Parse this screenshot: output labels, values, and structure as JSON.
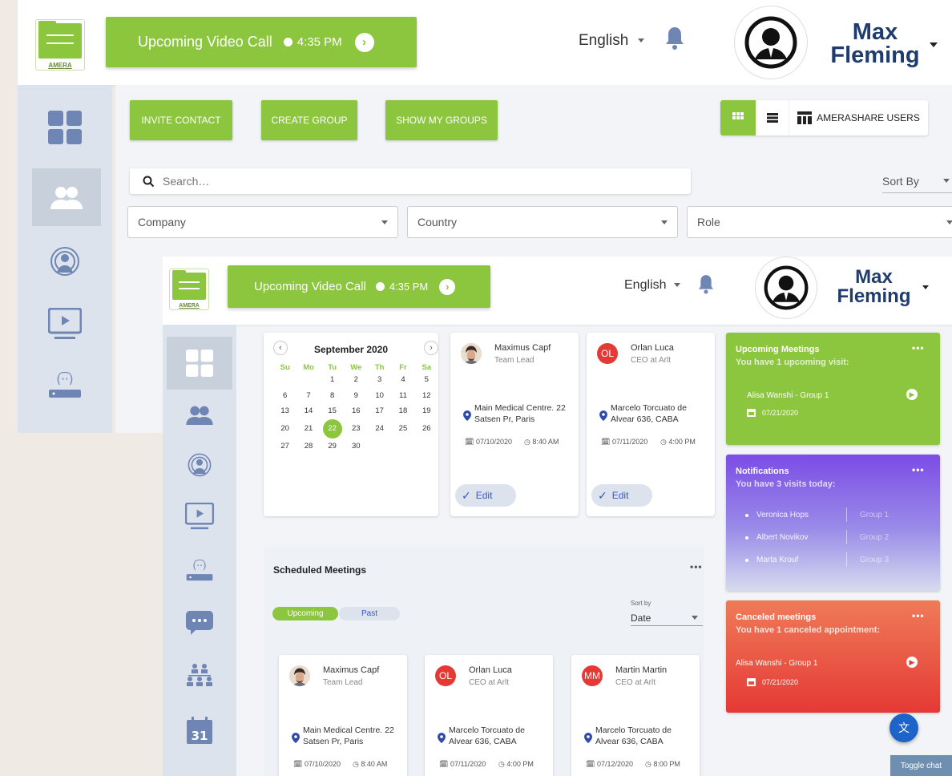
{
  "header": {
    "logo_text": "AMERA",
    "call_label": "Upcoming Video Call",
    "call_time": "4:35 PM",
    "language": "English",
    "user_first": "Max",
    "user_last": "Fleming"
  },
  "toolbar": {
    "invite": "INVITE CONTACT",
    "create_group": "CREATE GROUP",
    "show_groups": "SHOW MY GROUPS",
    "amerashare": "AMERASHARE USERS"
  },
  "search": {
    "placeholder": "Search…",
    "sort_by": "Sort By"
  },
  "filters": {
    "company": "Company",
    "country": "Country",
    "role": "Role"
  },
  "calendar": {
    "month": "September 2020",
    "days": [
      "Su",
      "Mo",
      "Tu",
      "We",
      "Th",
      "Fr",
      "Sa"
    ],
    "weeks": [
      [
        "",
        "",
        "1",
        "2",
        "3",
        "4",
        "5"
      ],
      [
        "6",
        "7",
        "8",
        "9",
        "10",
        "11",
        "12"
      ],
      [
        "13",
        "14",
        "15",
        "16",
        "17",
        "18",
        "19"
      ],
      [
        "20",
        "21",
        "22",
        "23",
        "24",
        "25",
        "26"
      ],
      [
        "27",
        "28",
        "29",
        "30",
        "",
        "",
        ""
      ]
    ],
    "selected": "22"
  },
  "top_cards": [
    {
      "name": "Maximus Capf",
      "role": "Team Lead",
      "address": "Main Medical Centre. 22 Satsen Pr, Paris",
      "date": "07/10/2020",
      "time": "8:40 AM",
      "edit": "Edit",
      "initials": ""
    },
    {
      "name": "Orlan Luca",
      "role": "CEO at Arlt",
      "address": "Marcelo Torcuato de Alvear 636, CABA",
      "date": "07/11/2020",
      "time": "4:00 PM",
      "edit": "Edit",
      "initials": "OL"
    }
  ],
  "scheduled": {
    "title": "Scheduled Meetings",
    "tab_upcoming": "Upcoming",
    "tab_past": "Past",
    "sort_label": "Sort by",
    "sort_value": "Date",
    "cards": [
      {
        "name": "Maximus Capf",
        "role": "Team Lead",
        "address": "Main Medical Centre. 22 Satsen Pr, Paris",
        "date": "07/10/2020",
        "time": "8:40 AM",
        "initials": ""
      },
      {
        "name": "Orlan Luca",
        "role": "CEO at Arlt",
        "address": "Marcelo Torcuato de Alvear 636, CABA",
        "date": "07/11/2020",
        "time": "4:00 PM",
        "initials": "OL"
      },
      {
        "name": "Martin Martin",
        "role": "CEO at Arlt",
        "address": "Marcelo Torcuato de Alvear 636, CABA",
        "date": "07/12/2020",
        "time": "8:00 PM",
        "initials": "MM"
      }
    ]
  },
  "upcoming_panel": {
    "title": "Upcoming Meetings",
    "subtitle": "You have 1 upcoming visit:",
    "item": "Alisa Wanshi - Group 1",
    "date": "07/21/2020",
    "color": "#8cc63f"
  },
  "notifications_panel": {
    "title": "Notifications",
    "subtitle": "You have 3 visits today:",
    "items": [
      {
        "name": "Veronica Hops",
        "group": "Group 1"
      },
      {
        "name": "Albert Novikov",
        "group": "Group 2"
      },
      {
        "name": "Marta Krouf",
        "group": "Group 3"
      }
    ]
  },
  "canceled_panel": {
    "title": "Canceled meetings",
    "subtitle": "You have 1 canceled appointment:",
    "item": "Alisa Wanshi - Group 1",
    "date": "07/21/2020"
  },
  "toggle_chat": "Toggle chat",
  "more": "•••"
}
